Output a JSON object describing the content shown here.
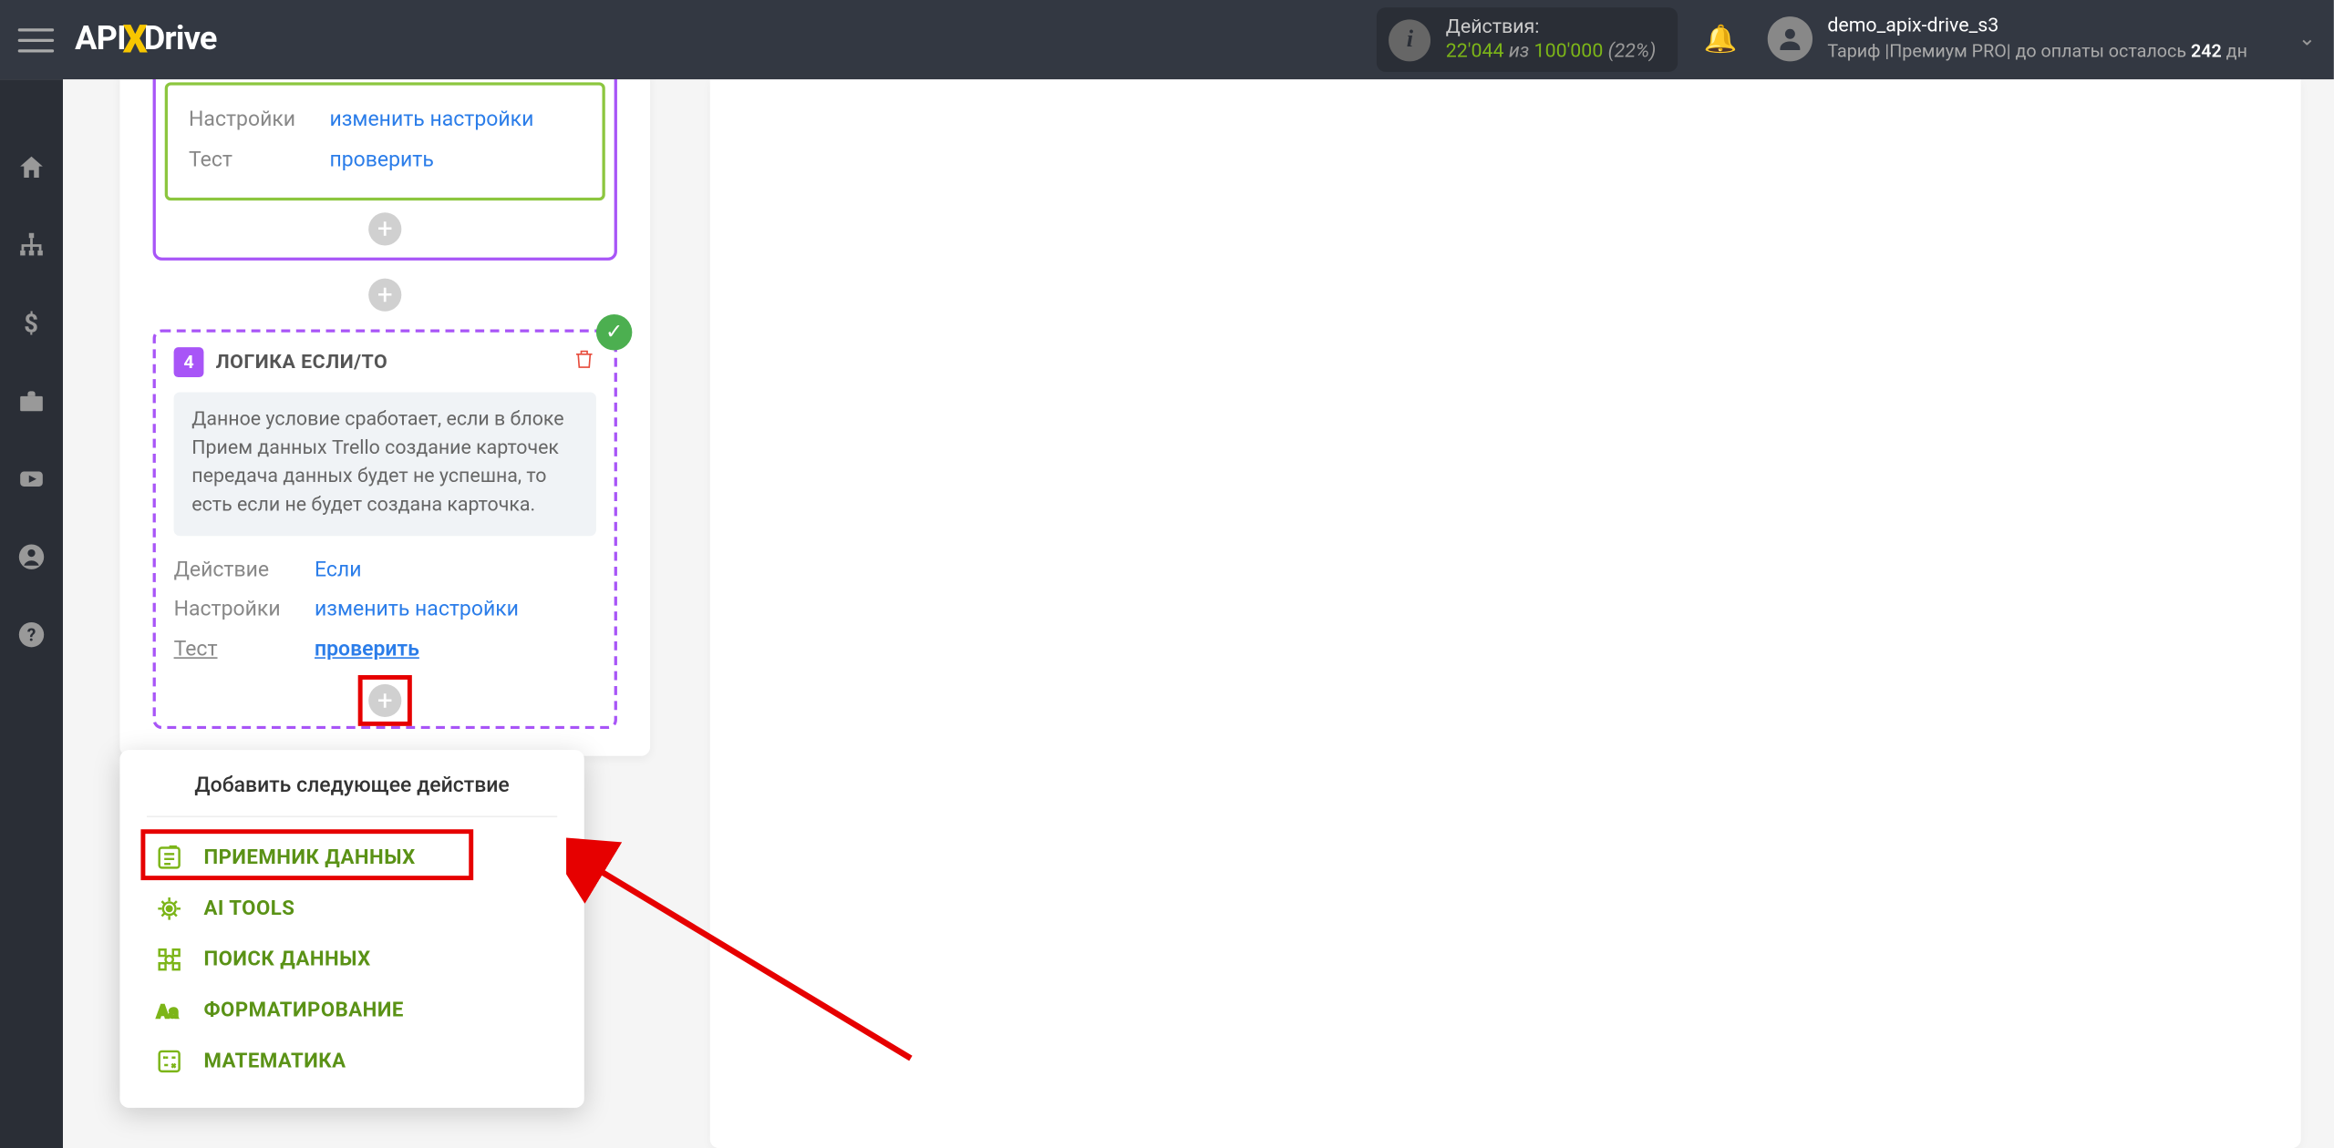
{
  "header": {
    "logo_api": "API",
    "logo_drive": "Drive",
    "actions_label": "Действия:",
    "actions_used": "22'044",
    "actions_of": " из ",
    "actions_total": "100'000",
    "actions_pct": " (22%)",
    "user_name": "demo_apix-drive_s3",
    "tariff_prefix": "Тариф |Премиум PRO| до оплаты осталось ",
    "tariff_days": "242",
    "tariff_suffix": " дн"
  },
  "block_green": {
    "row1_k": "Настройки",
    "row1_v": "изменить настройки",
    "row2_k": "Тест",
    "row2_v": "проверить"
  },
  "block4": {
    "num": "4",
    "title": "ЛОГИКА ЕСЛИ/ТО",
    "desc": "Данное условие сработает, если в блоке Прием данных Trello создание карточек передача данных будет не успешна, то есть если не будет создана карточка.",
    "rows": {
      "action_k": "Действие",
      "action_v": "Если",
      "settings_k": "Настройки",
      "settings_v": "изменить настройки",
      "test_k": "Тест",
      "test_v": "проверить"
    }
  },
  "dropdown": {
    "title": "Добавить следующее действие",
    "items": {
      "receiver": "ПРИЕМНИК ДАННЫХ",
      "ai": "AI TOOLS",
      "search": "ПОИСК ДАННЫХ",
      "format": "ФОРМАТИРОВАНИЕ",
      "math": "МАТЕМАТИКА"
    }
  }
}
